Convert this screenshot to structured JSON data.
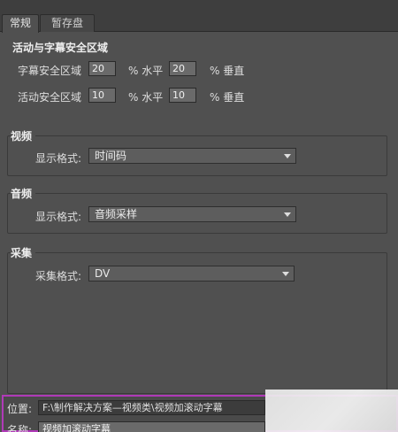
{
  "tabs": [
    {
      "label": "常规",
      "active": true
    },
    {
      "label": "暂存盘",
      "active": false
    }
  ],
  "safe_areas": {
    "title": "活动与字幕安全区域",
    "title_safe": {
      "label": "字幕安全区域",
      "h_value": "20",
      "h_unit": "% 水平",
      "v_value": "20",
      "v_unit": "% 垂直"
    },
    "action_safe": {
      "label": "活动安全区域",
      "h_value": "10",
      "h_unit": "% 水平",
      "v_value": "10",
      "v_unit": "% 垂直"
    }
  },
  "video": {
    "title": "视频",
    "display_format_label": "显示格式:",
    "display_format_value": "时间码"
  },
  "audio": {
    "title": "音频",
    "display_format_label": "显示格式:",
    "display_format_value": "音频采样"
  },
  "capture": {
    "title": "采集",
    "capture_format_label": "采集格式:",
    "capture_format_value": "DV"
  },
  "location": {
    "label": "位置:",
    "value": "F:\\制作解决方案—视频类\\视频加滚动字幕"
  },
  "name": {
    "label": "名称:",
    "value": "视频加滚动字幕"
  },
  "colors": {
    "panel_bg": "#505050",
    "highlight_border": "#b03ab8"
  }
}
